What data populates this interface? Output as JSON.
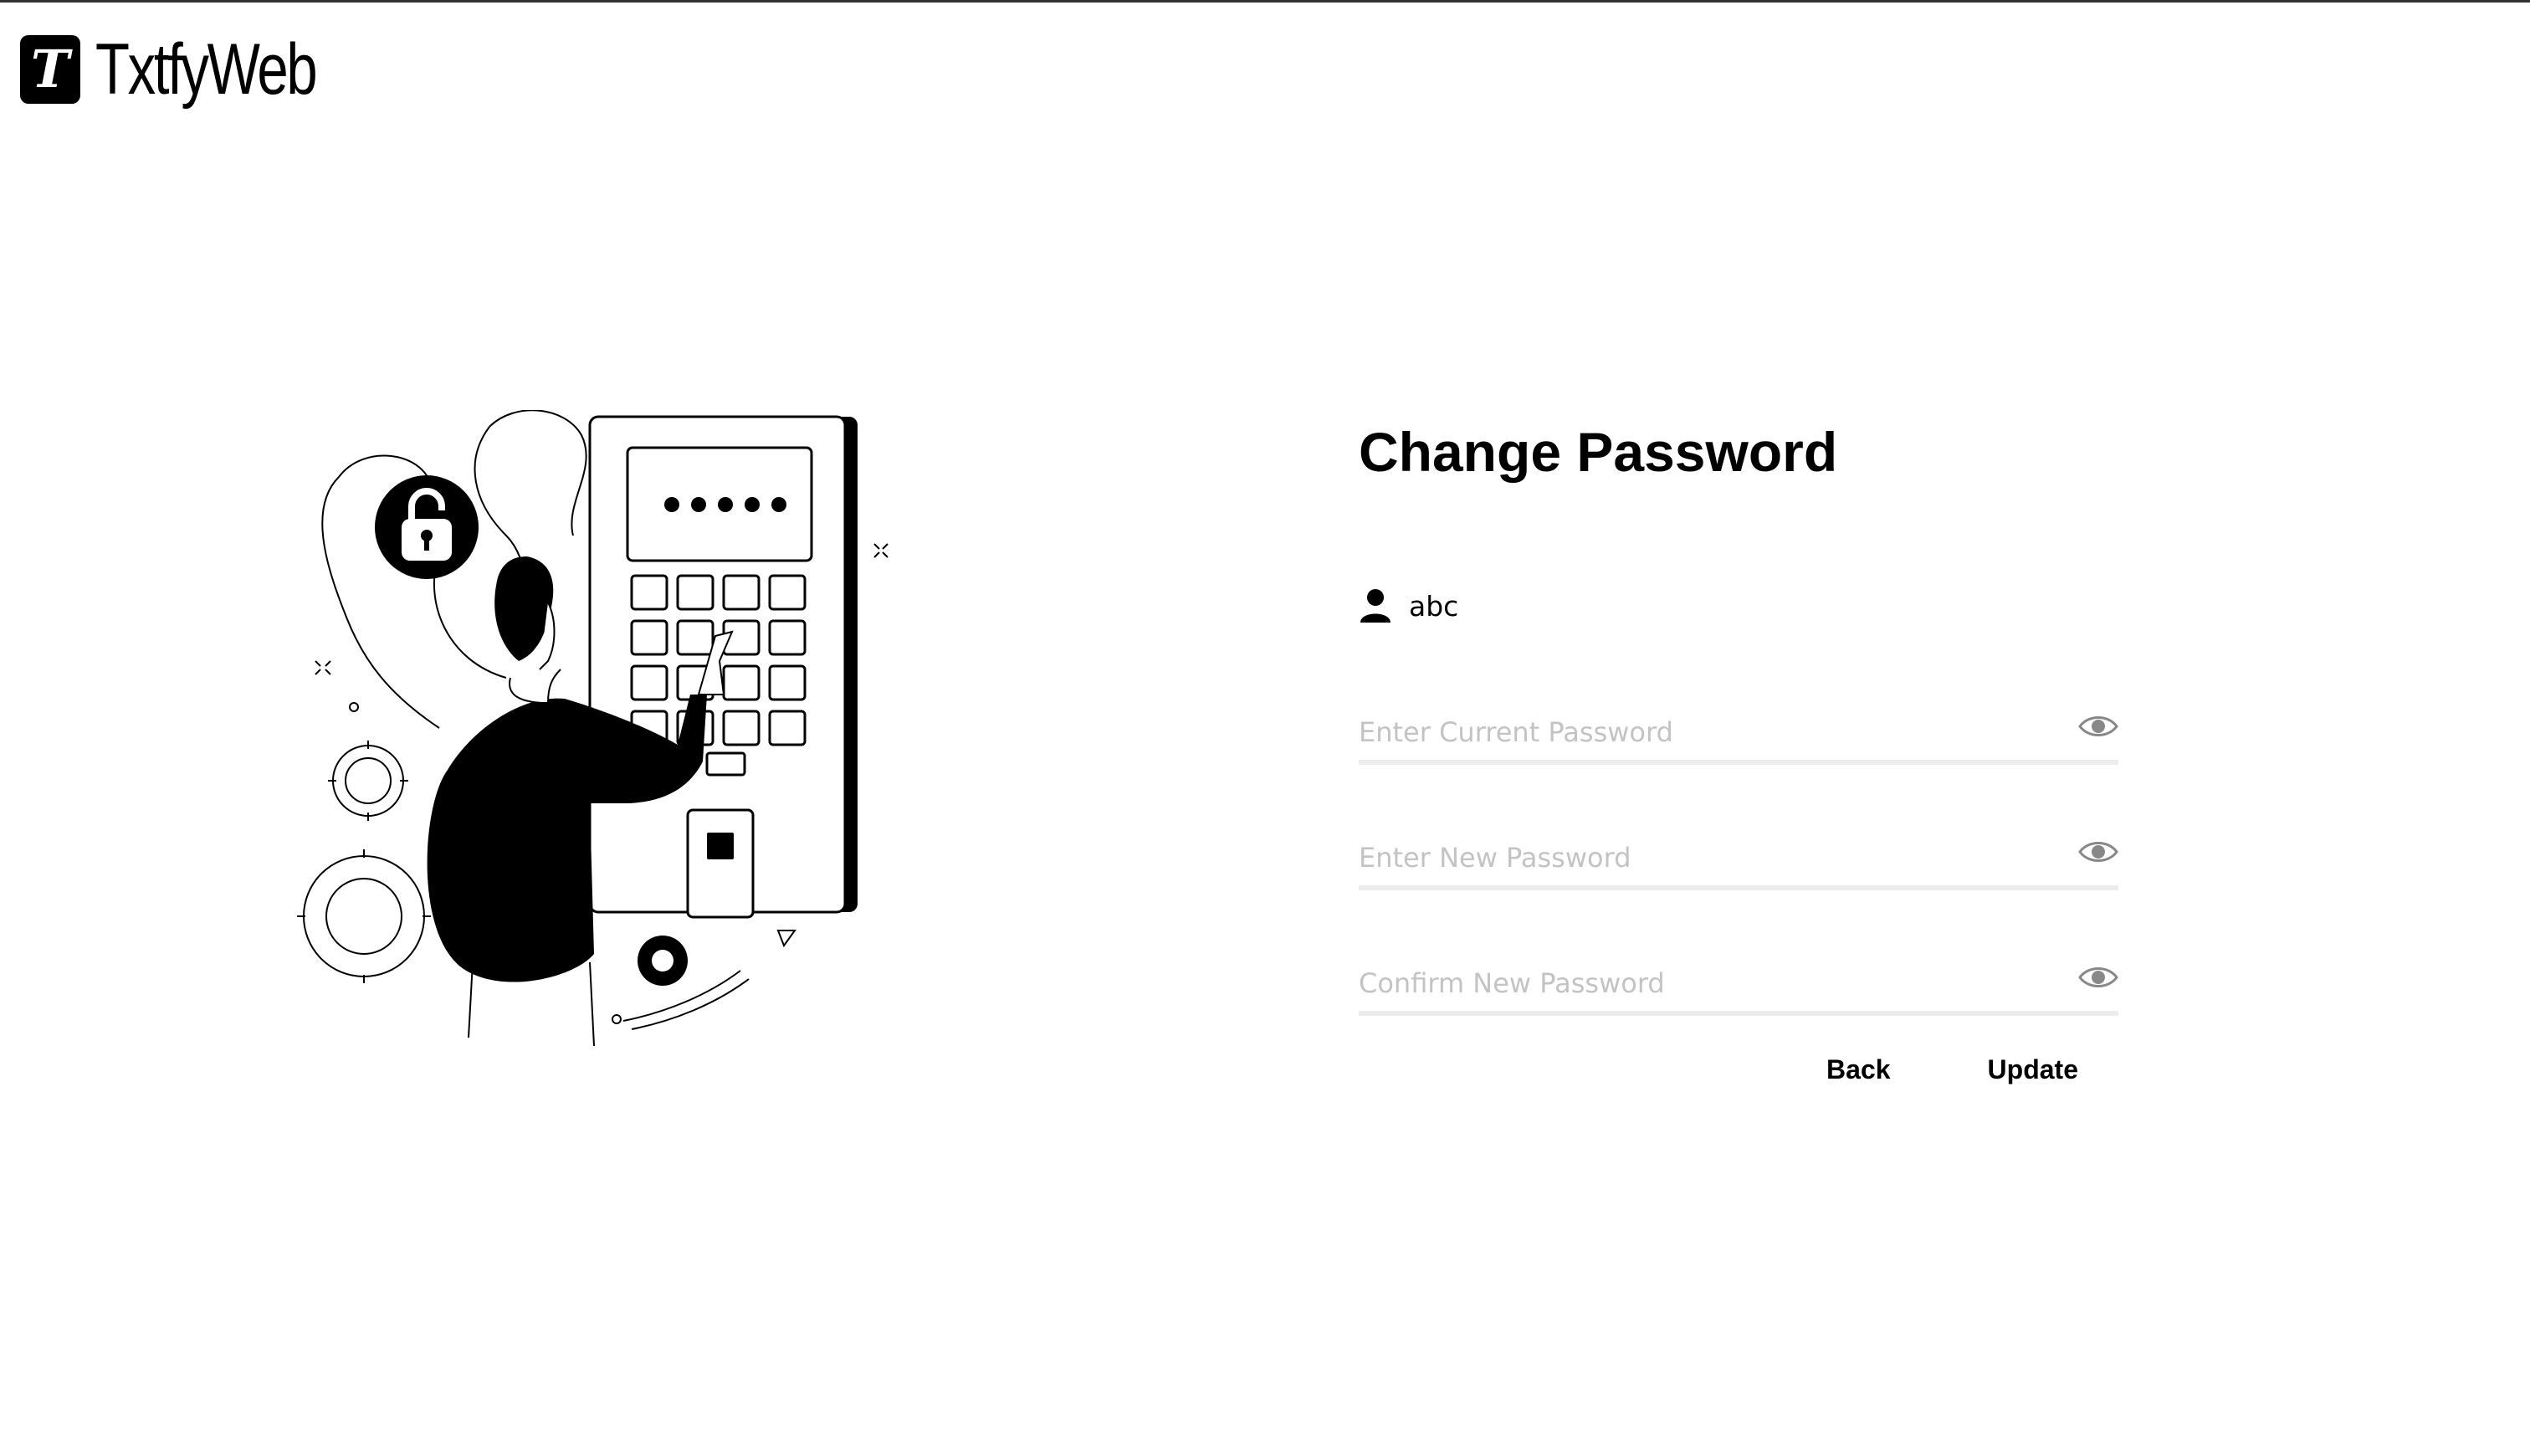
{
  "app": {
    "logo_letter": "T",
    "name": "TxtfyWeb"
  },
  "form": {
    "title": "Change Password",
    "username": "abc",
    "fields": [
      {
        "placeholder": "Enter Current Password",
        "value": ""
      },
      {
        "placeholder": "Enter New Password",
        "value": ""
      },
      {
        "placeholder": "Confirm New Password",
        "value": ""
      }
    ],
    "back_label": "Back",
    "update_label": "Update"
  },
  "keypad": {
    "display": "•••••"
  },
  "icons": {
    "user": "user-icon",
    "eye": "eye-icon",
    "lock": "padlock-icon",
    "gear": "gear-icon"
  },
  "colors": {
    "text": "#000000",
    "placeholder": "#c3c3c3",
    "underline": "#ececec",
    "background": "#ffffff"
  }
}
